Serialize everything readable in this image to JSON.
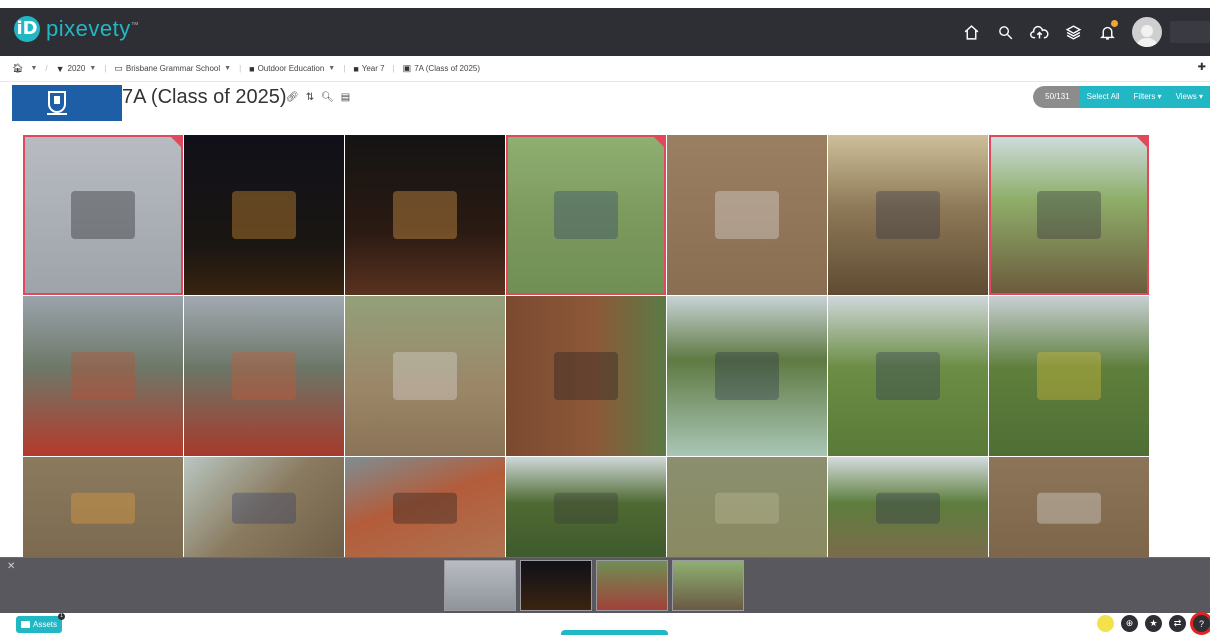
{
  "app": {
    "logo_mark": "iD",
    "logo_text": "pixevety",
    "logo_tm": "™"
  },
  "top_nav": {
    "icons": [
      "home-icon",
      "search-icon",
      "upload-cloud-icon",
      "layers-icon",
      "bell-icon",
      "avatar"
    ],
    "notification_count": "1"
  },
  "breadcrumb": [
    {
      "icon": "home-icon",
      "label": "",
      "has_caret": true
    },
    {
      "icon": "filter-icon",
      "label": "2020",
      "has_caret": true
    },
    {
      "icon": "school-icon",
      "label": "Brisbane Grammar School",
      "has_caret": true
    },
    {
      "icon": "folder-icon",
      "label": "Outdoor Education",
      "has_caret": true
    },
    {
      "icon": "folder-icon",
      "label": "Year 7",
      "has_caret": false
    },
    {
      "icon": "album-icon",
      "label": "7A (Class of 2025)",
      "has_caret": false
    }
  ],
  "album": {
    "title": "7A (Class of 2025)",
    "tools": [
      "link-icon",
      "sort-icon",
      "zoom-icon",
      "document-icon"
    ]
  },
  "toolbar": {
    "count": "50/131",
    "select_all": "Select All",
    "filters": "Filters ▾",
    "views": "Views ▾"
  },
  "photos": [
    {
      "selected": true,
      "bg": "linear-gradient(180deg,#b8bcc2 0%,#9ea3aa 100%)",
      "hint": "#1b1b1b"
    },
    {
      "selected": false,
      "bg": "linear-gradient(180deg,#101018 0%,#1a1612 70%,#3a2410 100%)",
      "hint": "#f2a33a"
    },
    {
      "selected": false,
      "bg": "linear-gradient(180deg,#141414 0%,#2a1a12 60%,#5a3220 100%)",
      "hint": "#f6b052"
    },
    {
      "selected": true,
      "bg": "linear-gradient(180deg,#8fb072 0%,#7d9a5e 50%,#6f8f55 100%)",
      "hint": "#2c3e6e"
    },
    {
      "selected": false,
      "bg": "linear-gradient(180deg,#9a7f62 0%,#8a6e52 100%)",
      "hint": "#e8e8e8"
    },
    {
      "selected": false,
      "bg": "linear-gradient(180deg,#cdbf9a 0%,#8e7a58 45%,#5f4b32 100%)",
      "hint": "#2a2e44"
    },
    {
      "selected": true,
      "bg": "linear-gradient(180deg,#cfdde0 0%,#8fae6a 40%,#6b5a3c 100%)",
      "hint": "#2c2c3c"
    },
    {
      "selected": false,
      "bg": "linear-gradient(180deg,#9aa3ab 0%,#6d7868 45%,#b43a2c 100%)",
      "hint": "#c64b2e"
    },
    {
      "selected": false,
      "bg": "linear-gradient(180deg,#a2aab2 0%,#6c7667 45%,#a63a2c 100%)",
      "hint": "#d3552f"
    },
    {
      "selected": false,
      "bg": "linear-gradient(180deg,#93a07a 0%,#9b8567 60%,#8a7356 100%)",
      "hint": "#e3e3e3"
    },
    {
      "selected": false,
      "bg": "linear-gradient(90deg,#7a4a30 0%,#8d5838 55%,#5b7a45 100%)",
      "hint": "#1c1c22"
    },
    {
      "selected": false,
      "bg": "linear-gradient(180deg,#c8d3d6 0%,#5f7a42 40%,#a9c6b6 100%)",
      "hint": "#27324a"
    },
    {
      "selected": false,
      "bg": "linear-gradient(180deg,#cfd7d9 0%,#6b8d44 45%,#5a7a38 100%)",
      "hint": "#2b3555"
    },
    {
      "selected": false,
      "bg": "linear-gradient(180deg,#c7d0d4 0%,#5f7f3c 45%,#4f6e34 100%)",
      "hint": "#e3c33a"
    },
    {
      "selected": false,
      "bg": "linear-gradient(180deg,#8b7a5e 0%,#7b6a4f 100%)",
      "hint": "#f0a33a"
    },
    {
      "selected": false,
      "bg": "linear-gradient(135deg,#b9c6c1 0%,#8a7b60 50%,#6f5e46 100%)",
      "hint": "#2e3a6a"
    },
    {
      "selected": false,
      "bg": "linear-gradient(160deg,#7e8e92 0%,#b35c3a 45%,#ae7452 100%)",
      "hint": "#1c1c1c"
    },
    {
      "selected": false,
      "bg": "linear-gradient(180deg,#cfd8d8 0%,#4f6a32 45%,#3f5a2c 100%)",
      "hint": "#3a3a3a"
    },
    {
      "selected": false,
      "bg": "linear-gradient(180deg,#8b8f6e 0%,#8a8a62 100%)",
      "hint": "#bfbf9a"
    },
    {
      "selected": false,
      "bg": "linear-gradient(180deg,#d4dcde 0%,#5e7e3e 45%,#7b6b4c 100%)",
      "hint": "#2a304a"
    },
    {
      "selected": false,
      "bg": "linear-gradient(180deg,#8d7559 0%,#7d6549 100%)",
      "hint": "#e6e6e6"
    }
  ],
  "filmstrip": {
    "close": "✕",
    "thumbs": [
      "linear-gradient(180deg,#b8bcc2,#8f949b)",
      "linear-gradient(180deg,#101018,#3a2410)",
      "linear-gradient(180deg,#6f8f55,#a0413a)",
      "linear-gradient(180deg,#8fb072,#6a5a44)"
    ]
  },
  "footer": {
    "assets_label": "Assets",
    "assets_badge": "1",
    "buttons": [
      "star-icon",
      "cart-icon",
      "favorite-icon",
      "share-icon",
      "help-icon"
    ]
  },
  "colors": {
    "brand_teal": "#21b7c4",
    "dark_bar": "#2e2e35",
    "selection_red": "#e1485b",
    "school_blue": "#1e5ea6"
  }
}
